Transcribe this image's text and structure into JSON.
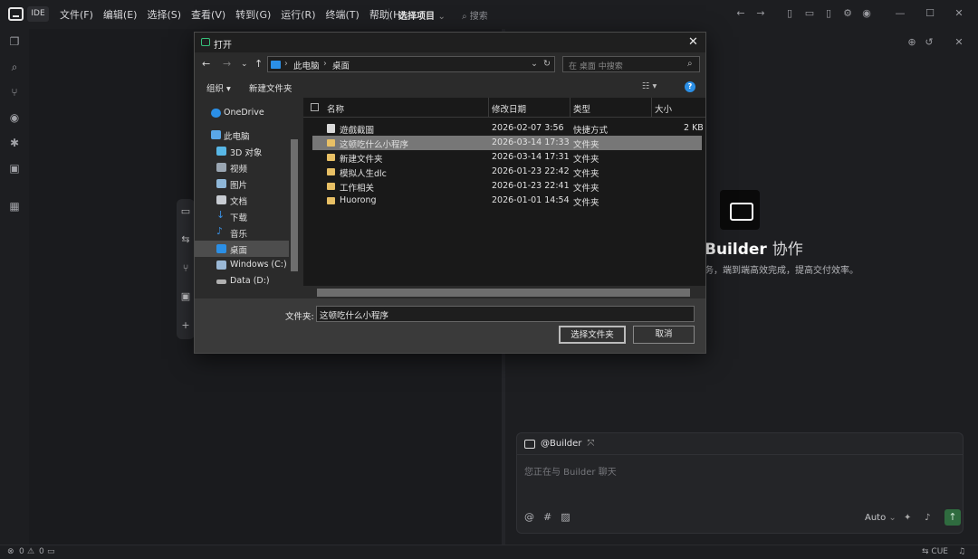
{
  "app": {
    "badge": "IDE"
  },
  "menu": [
    "文件(F)",
    "编辑(E)",
    "选择(S)",
    "查看(V)",
    "转到(G)",
    "运行(R)",
    "终端(T)",
    "帮助(H)"
  ],
  "project_selector": "选择项目",
  "search_label": "搜索",
  "brand": {
    "title": "Builder",
    "subtitle_word": "协作",
    "tagline": "务，端到端高效完成，提高交付效率。"
  },
  "chat": {
    "mention": "@Builder",
    "placeholder": "您正在与 Builder 聊天",
    "model": "Auto"
  },
  "status": {
    "errors": "0",
    "warnings": "0",
    "right": "CUE"
  },
  "dialog": {
    "title": "打开",
    "path": [
      "此电脑",
      "桌面"
    ],
    "search_placeholder": "在 桌面 中搜索",
    "organize": "组织 ▾",
    "new_folder": "新建文件夹",
    "nav": [
      "OneDrive",
      "此电脑",
      "3D 对象",
      "视频",
      "图片",
      "文档",
      "下载",
      "音乐",
      "桌面",
      "Windows (C:)",
      "Data (D:)"
    ],
    "nav_selected": "桌面",
    "columns": {
      "name": "名称",
      "date": "修改日期",
      "type": "类型",
      "size": "大小"
    },
    "files": [
      {
        "name": "遊戲截圖",
        "date": "2026-02-07 3:56",
        "type": "快捷方式",
        "size": "2 KB",
        "kind": "shortcut"
      },
      {
        "name": "这顿吃什么小程序",
        "date": "2026-03-14 17:33",
        "type": "文件夹",
        "size": "",
        "kind": "folder",
        "selected": true
      },
      {
        "name": "新建文件夹",
        "date": "2026-03-14 17:31",
        "type": "文件夹",
        "size": "",
        "kind": "folder"
      },
      {
        "name": "模拟人生dlc",
        "date": "2026-01-23 22:42",
        "type": "文件夹",
        "size": "",
        "kind": "folder"
      },
      {
        "name": "工作相关",
        "date": "2026-01-23 22:41",
        "type": "文件夹",
        "size": "",
        "kind": "folder"
      },
      {
        "name": "Huorong",
        "date": "2026-01-01 14:54",
        "type": "文件夹",
        "size": "",
        "kind": "folder"
      }
    ],
    "folder_label": "文件夹:",
    "folder_value": "这顿吃什么小程序",
    "select_button": "选择文件夹",
    "cancel_button": "取消"
  }
}
